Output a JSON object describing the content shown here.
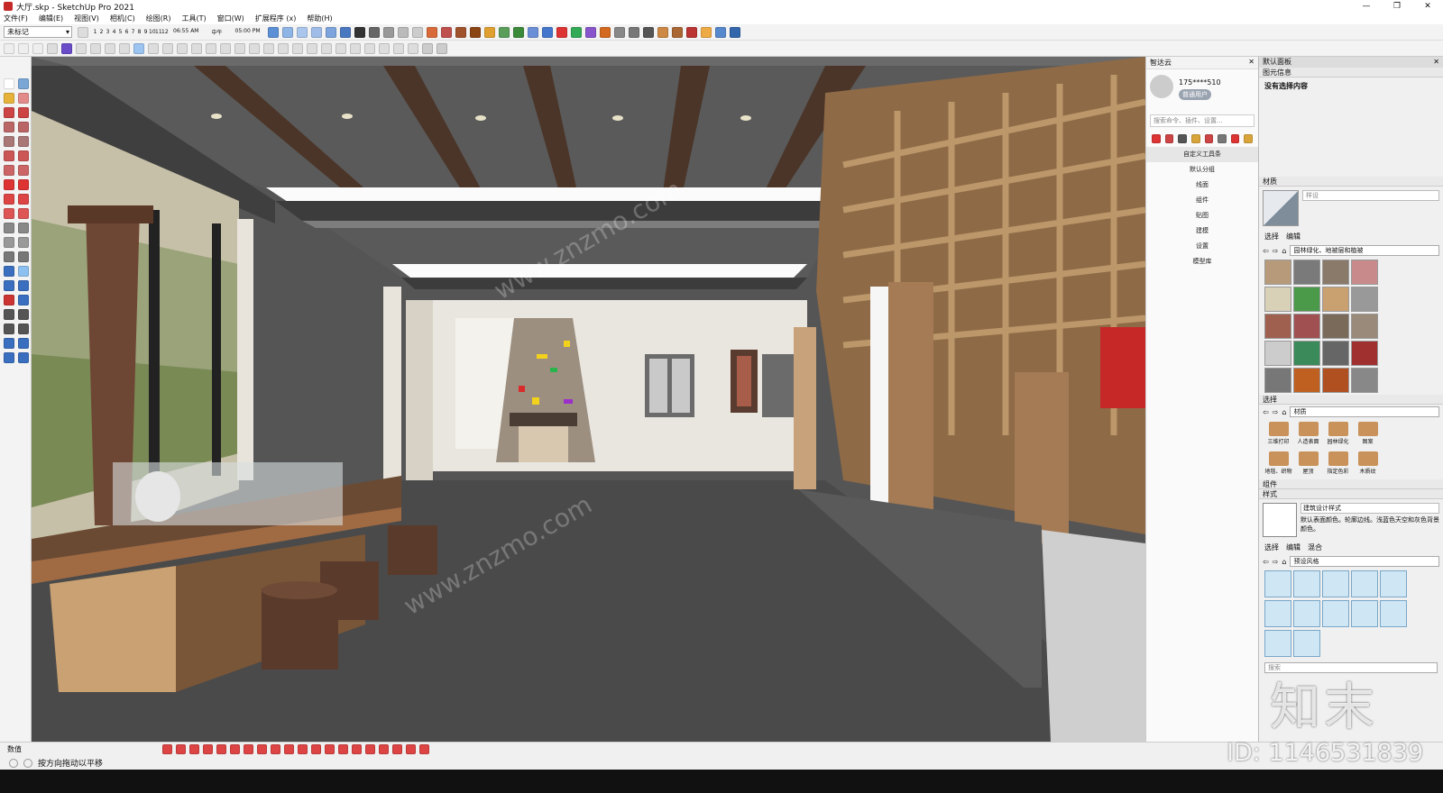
{
  "window": {
    "title": "大厅.skp - SketchUp Pro 2021",
    "controls": [
      "—",
      "❐",
      "✕"
    ]
  },
  "menu": [
    "文件(F)",
    "编辑(E)",
    "视图(V)",
    "相机(C)",
    "绘图(R)",
    "工具(T)",
    "窗口(W)",
    "扩展程序 (x)",
    "帮助(H)"
  ],
  "toolbar": {
    "tag_select": "未标记",
    "month_ruler": [
      "1",
      "2",
      "3",
      "4",
      "5",
      "6",
      "7",
      "8",
      "9",
      "10",
      "11",
      "12"
    ],
    "time_start": "06:55 AM",
    "time_mid": "中午",
    "time_end": "05:00 PM"
  },
  "zhiyun": {
    "title": "智达云",
    "phone": "175****510",
    "badge": "普通用户",
    "search_placeholder": "搜索命令、插件、设置...",
    "menu": [
      "自定义工具条",
      "默认分组",
      "线面",
      "组件",
      "贴图",
      "建模",
      "设置",
      "模型库"
    ]
  },
  "tray": {
    "title": "默认面板",
    "entity_info": "图元信息",
    "no_selection": "没有选择内容",
    "materials": "材质",
    "material_name_placeholder": "样设",
    "tab_select": "选择",
    "tab_edit": "编辑",
    "library_dropdown": "园林绿化、地被层和植被",
    "select2": "选择",
    "materials_dropdown": "材质",
    "categories": [
      "三维打印",
      "人造表面",
      "园林绿化",
      "图案",
      "地毯、织物",
      "屋顶",
      "指定色彩",
      "木质纹"
    ],
    "components": "组件",
    "styles": "样式",
    "style_name": "建筑设计样式",
    "style_desc": "默认表面颜色。轮廓边线。浅蓝色天空和灰色背景颜色。",
    "tab_mix": "混合",
    "styles_dropdown": "预设风格",
    "search_placeholder": "搜索"
  },
  "measure_label": "数值",
  "status_text": "按方向拖动以平移",
  "watermark": {
    "logo": "知末",
    "id": "ID: 1146531839"
  }
}
